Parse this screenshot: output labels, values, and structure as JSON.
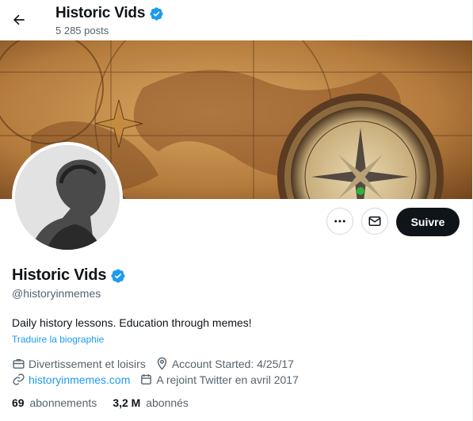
{
  "header": {
    "title": "Historic Vids",
    "posts_count": "5 285 posts",
    "back_icon": "arrow-left-icon",
    "verified_icon": "verified-badge-icon"
  },
  "profile": {
    "name": "Historic Vids",
    "handle": "@historyinmemes",
    "bio": "Daily history lessons. Education through memes!",
    "translate_label": "Traduire la biographie",
    "category": "Divertissement et loisirs",
    "location": "Account Started: 4/25/17",
    "website": "historyinmemes.com",
    "joined": "A rejoint Twitter en avril 2017",
    "following_count": "69",
    "following_label": "abonnements",
    "followers_count": "3,2 M",
    "followers_label": "abonnés"
  },
  "actions": {
    "more_icon": "more-icon",
    "message_icon": "mail-icon",
    "follow_label": "Suivre"
  },
  "colors": {
    "accent": "#1d9bf0",
    "text_primary": "#0f1419",
    "text_secondary": "#536471",
    "follow_bg": "#0f1419"
  }
}
